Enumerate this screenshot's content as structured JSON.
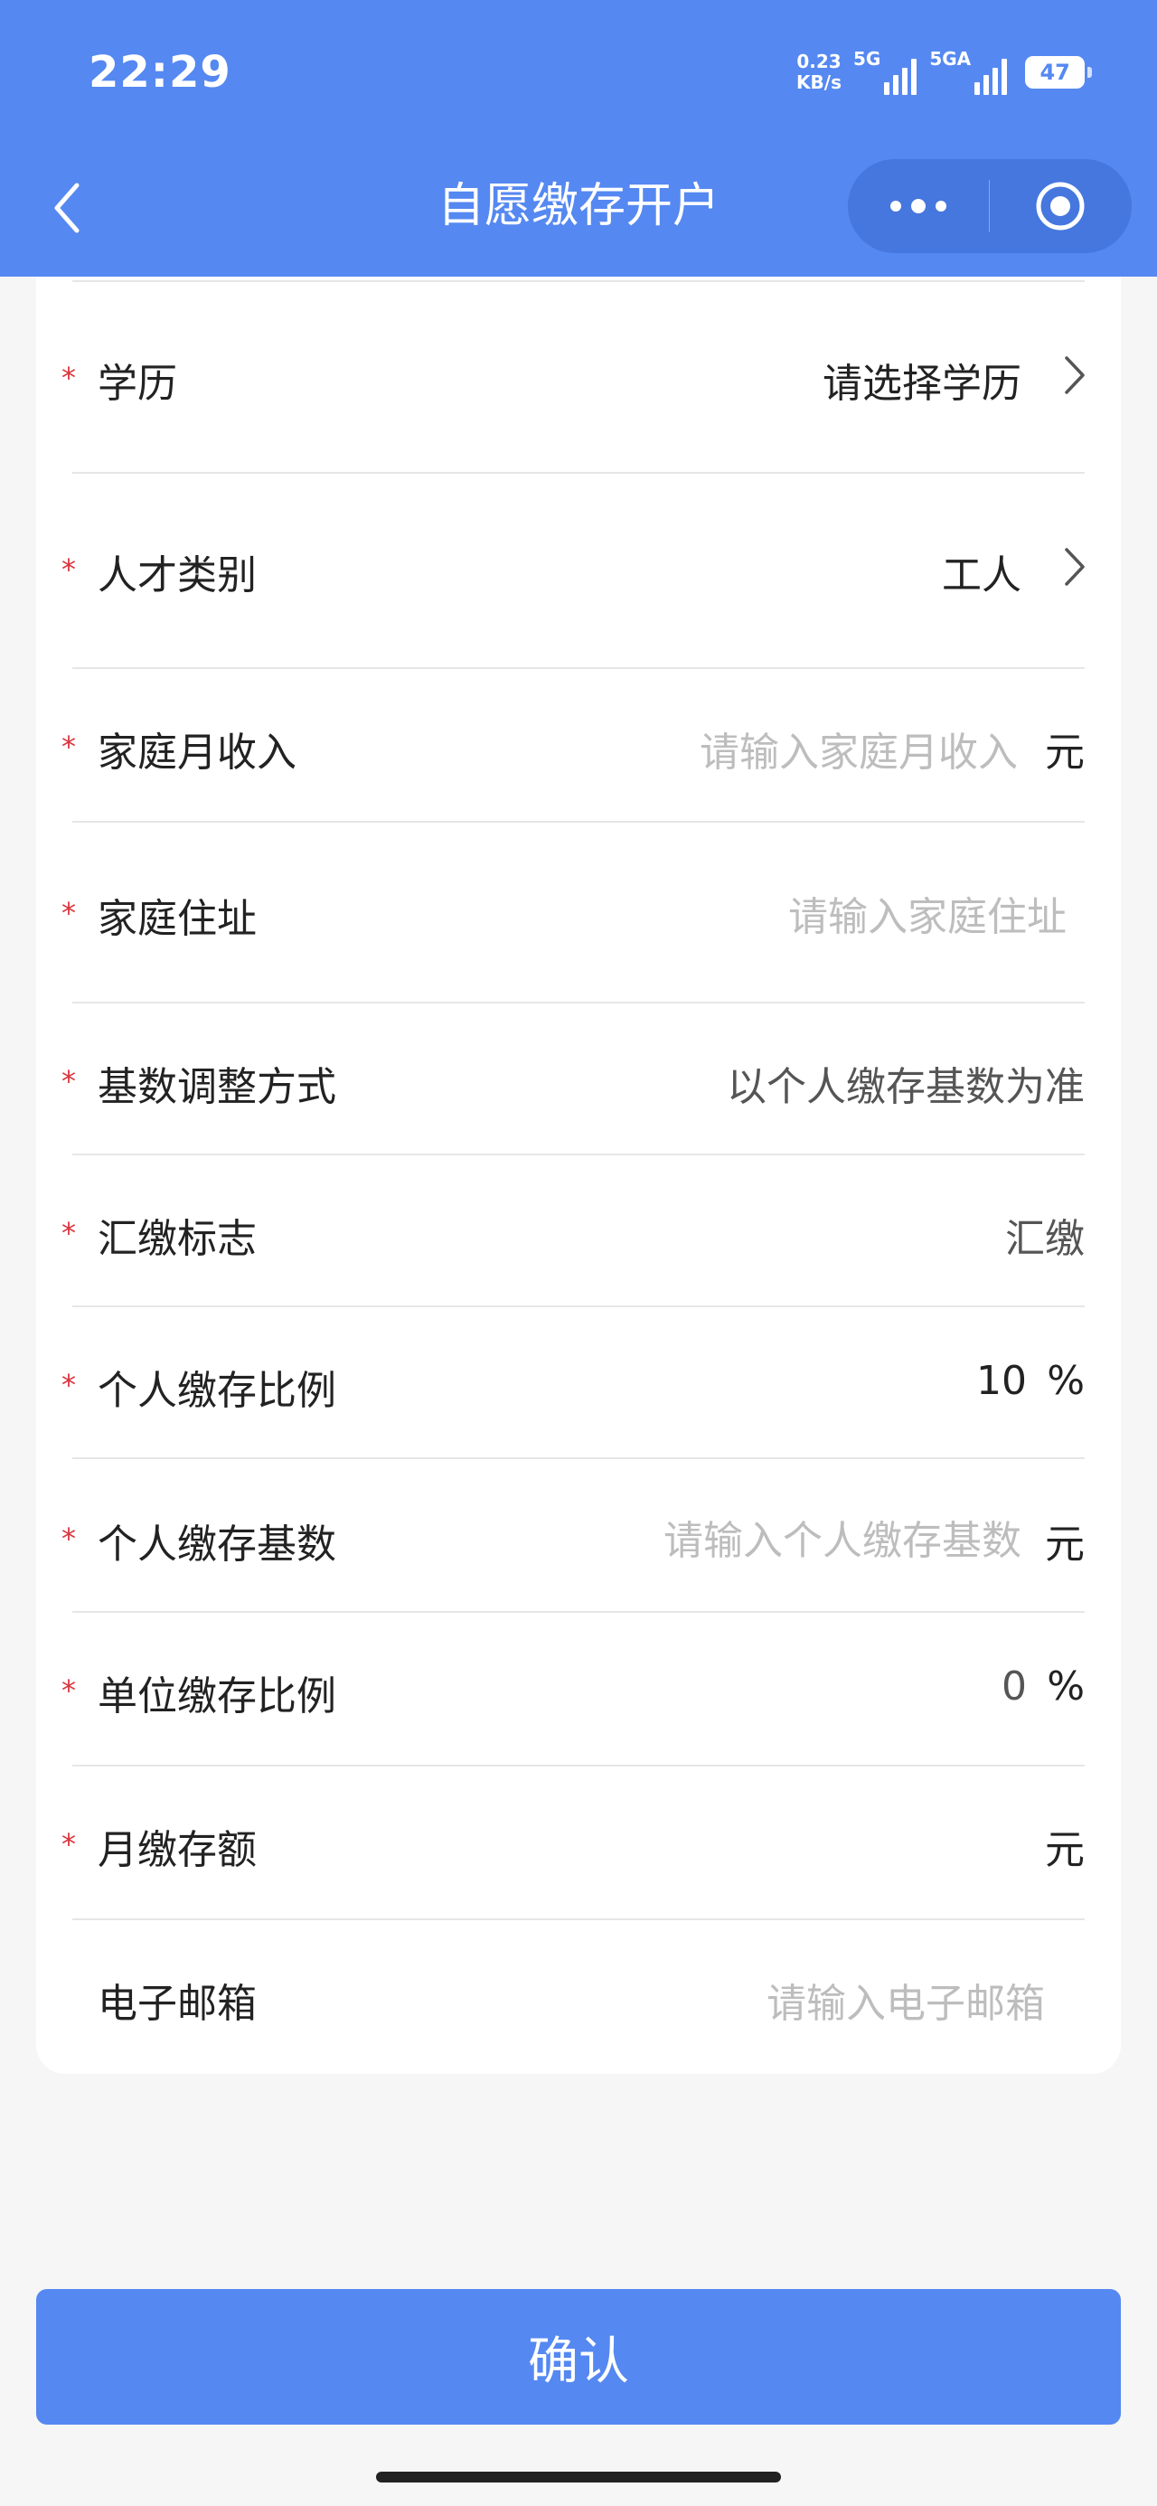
{
  "status_bar": {
    "time": "22:29",
    "net_speed_value": "0.23",
    "net_speed_unit": "KB/s",
    "signal1_label": "5G",
    "signal2_label": "5GA",
    "battery": "47"
  },
  "header": {
    "title": "自愿缴存开户"
  },
  "colors": {
    "brand": "#5588f1",
    "required_star": "#d9363e",
    "placeholder": "#bdbdbd"
  },
  "form": {
    "education": {
      "label": "学历",
      "value": "请选择学历"
    },
    "talent_type": {
      "label": "人才类别",
      "value": "工人"
    },
    "family_income": {
      "label": "家庭月收入",
      "placeholder": "请输入家庭月收入",
      "unit": "元"
    },
    "family_address": {
      "label": "家庭住址",
      "placeholder": "请输入家庭住址"
    },
    "base_adjust": {
      "label": "基数调整方式",
      "value": "以个人缴存基数为准"
    },
    "remit_flag": {
      "label": "汇缴标志",
      "value": "汇缴"
    },
    "personal_ratio": {
      "label": "个人缴存比例",
      "value": "10",
      "unit": "%"
    },
    "personal_base": {
      "label": "个人缴存基数",
      "placeholder": "请输入个人缴存基数",
      "unit": "元"
    },
    "unit_ratio": {
      "label": "单位缴存比例",
      "value": "0",
      "unit": "%"
    },
    "monthly_amount": {
      "label": "月缴存额",
      "unit": "元"
    },
    "email": {
      "label": "电子邮箱",
      "placeholder": "请输入电子邮箱"
    },
    "required_mark": "*"
  },
  "actions": {
    "confirm_label": "确认"
  }
}
